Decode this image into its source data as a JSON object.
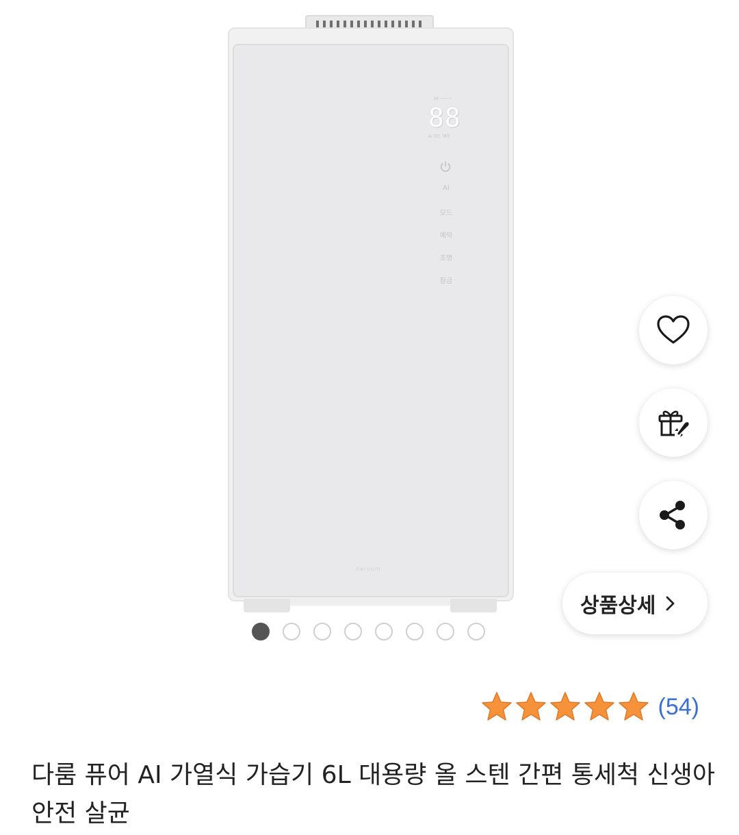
{
  "product_image": {
    "display_digits": "88",
    "display_top_labels": "AI  ~~~",
    "display_bottom_labels": "AI 모드 예약",
    "controls": [
      "AI",
      "모드",
      "예약",
      "조명",
      "잠금"
    ],
    "brand_mark": "daroom"
  },
  "carousel": {
    "total": 8,
    "active_index": 0
  },
  "actions": {
    "wishlist_icon": "heart-icon",
    "gift_icon": "gift-icon",
    "share_icon": "share-icon",
    "detail_label": "상품상세"
  },
  "rating": {
    "stars": 5,
    "star_color": "#f5923a",
    "review_count": "(54)"
  },
  "product": {
    "title": "다룸 퓨어 AI 가열식 가습기 6L 대용량 올 스텐 간편 통세척 신생아 안전 살균"
  }
}
